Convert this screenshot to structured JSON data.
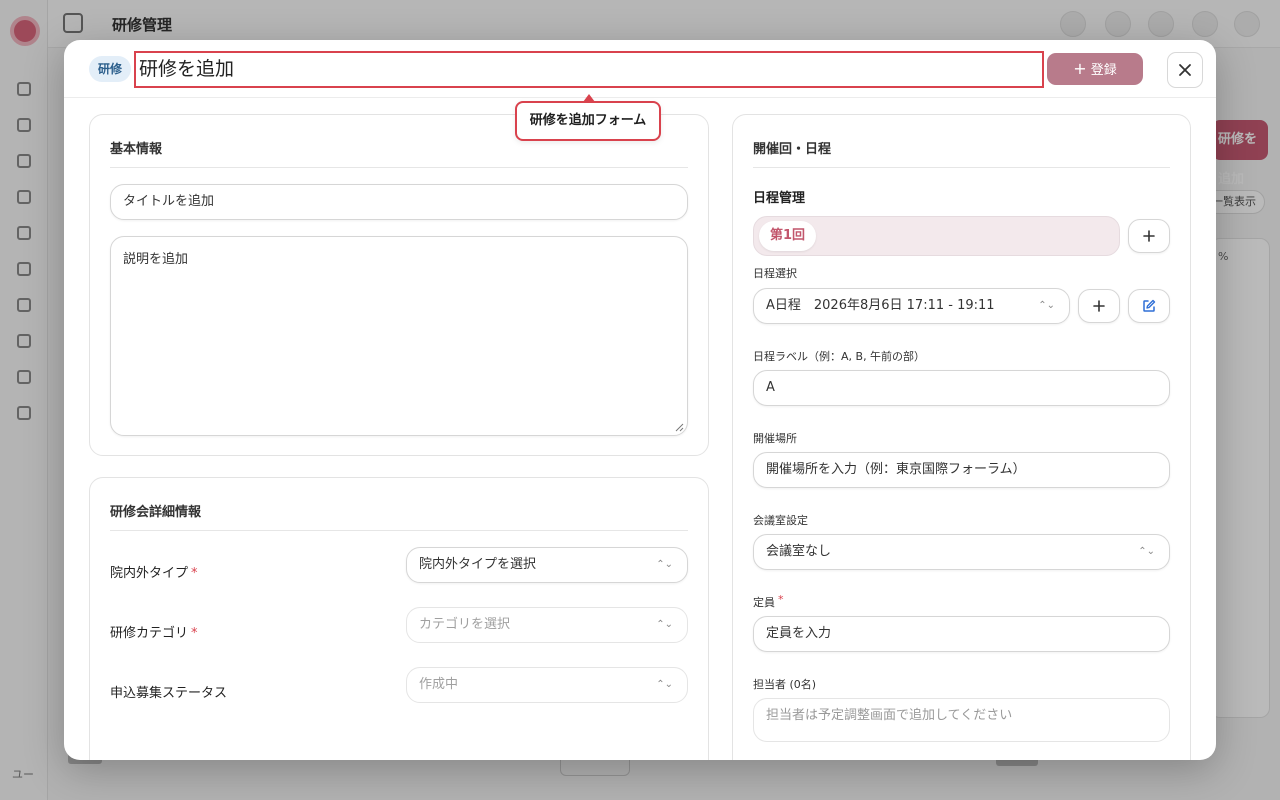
{
  "background": {
    "page_title": "研修管理",
    "add_button_label": "研修を追加",
    "chip_label": "一覧表示",
    "card_text": "%",
    "sidebar_bottom_label": "ユー"
  },
  "header": {
    "type_badge": "研修",
    "title_value": "研修を追加",
    "register_label": "登録",
    "register_icon": "plus-icon",
    "close_icon": "close-icon"
  },
  "callout": {
    "label": "研修を追加フォーム"
  },
  "basic_info": {
    "section_title": "基本情報",
    "title_placeholder": "タイトルを追加",
    "description_placeholder": "説明を追加"
  },
  "detail_info": {
    "section_title": "研修会詳細情報",
    "rows": [
      {
        "label": "院内外タイプ",
        "required": true,
        "value": "院内外タイプを選択",
        "enabled": true
      },
      {
        "label": "研修カテゴリ",
        "required": true,
        "value": "カテゴリを選択",
        "enabled": false
      },
      {
        "label": "申込募集ステータス",
        "required": false,
        "value": "作成中",
        "enabled": false
      }
    ]
  },
  "schedule": {
    "section_title": "開催回・日程",
    "manage_title": "日程管理",
    "session_chip": "第1回",
    "add_session_icon": "plus-icon",
    "select_label": "日程選択",
    "select_value": "A日程　2026年8月6日 17:11 - 19:11",
    "add_schedule_icon": "plus-icon",
    "edit_schedule_icon": "edit-icon",
    "label_label": "日程ラベル（例：A, B, 午前の部）",
    "label_value": "A",
    "venue_label": "開催場所",
    "venue_placeholder": "開催場所を入力（例：東京国際フォーラム）",
    "room_label": "会議室設定",
    "room_value": "会議室なし",
    "capacity_label": "定員",
    "capacity_required": "*",
    "capacity_placeholder": "定員を入力",
    "staff_label": "担当者 (0名)",
    "staff_placeholder": "担当者は予定調整画面で追加してください"
  },
  "colors": {
    "accent": "#c2566c",
    "highlight_border": "#d9424d",
    "register_button": "#b87b8b",
    "badge_bg": "#e3eef8"
  }
}
